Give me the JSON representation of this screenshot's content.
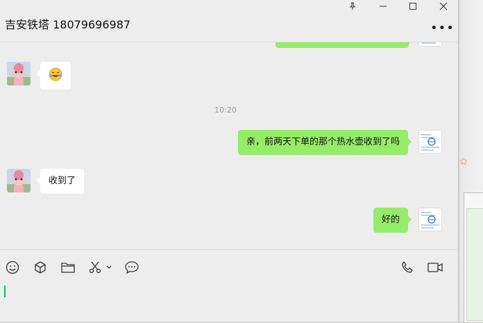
{
  "window": {
    "title": "吉安铁塔 18079696987",
    "pin_icon": "pin-icon",
    "minimize_icon": "minimize-icon",
    "maximize_icon": "maximize-icon",
    "close_icon": "close-icon",
    "more_label": "•••"
  },
  "messages": [
    {
      "side": "left",
      "type": "emoji",
      "icon": "laughing-emoji-icon",
      "text": "😂"
    },
    {
      "side": "center",
      "type": "timestamp",
      "text": "10:20"
    },
    {
      "side": "right",
      "type": "text",
      "text": "亲，前两天下单的那个热水壶收到了吗"
    },
    {
      "side": "left",
      "type": "text",
      "text": "收到了"
    },
    {
      "side": "right",
      "type": "text",
      "text": "好的"
    }
  ],
  "toolbar": {
    "left": [
      "emoji-icon",
      "box-icon",
      "folder-icon",
      "scissors-icon",
      "chevron-down-icon",
      "chat-bubble-icon"
    ],
    "right": [
      "phone-icon",
      "video-icon"
    ]
  },
  "colors": {
    "bubble_self": "#95ec69",
    "bubble_other": "#ffffff",
    "background": "#ededed",
    "caret": "#07c160"
  }
}
